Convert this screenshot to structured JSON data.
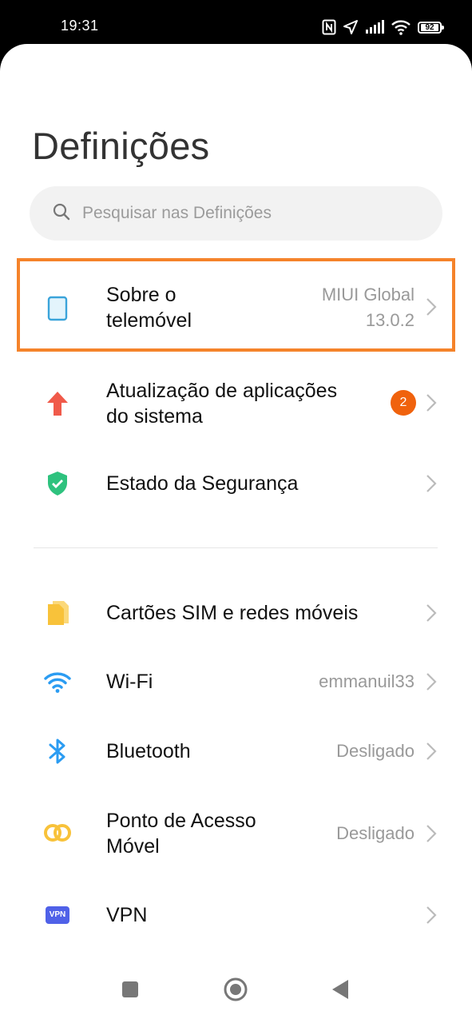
{
  "status_bar": {
    "time": "19:31",
    "battery": "92",
    "icons": [
      "nfc-icon",
      "location-icon",
      "signal-icon",
      "wifi-icon",
      "battery-icon"
    ]
  },
  "page": {
    "title": "Definições"
  },
  "search": {
    "placeholder": "Pesquisar nas Definições",
    "icon": "search-icon"
  },
  "settings": {
    "about": {
      "label_line1": "Sobre o",
      "label_line2": "telemóvel",
      "value_line1": "MIUI Global",
      "value_line2": "13.0.2",
      "icon": "phone-icon",
      "highlighted": true,
      "highlight_color": "#f5832a"
    },
    "updates": {
      "label_line1": "Atualização de aplicações",
      "label_line2": "do sistema",
      "badge": "2",
      "icon": "update-arrow-icon",
      "badge_color": "#f0620d"
    },
    "security": {
      "label": "Estado da Segurança",
      "icon": "shield-icon"
    },
    "sim": {
      "label": "Cartões SIM e redes móveis",
      "icon": "sim-icon"
    },
    "wifi": {
      "label": "Wi-Fi",
      "value": "emmanuil33",
      "icon": "wifi-icon"
    },
    "bluetooth": {
      "label": "Bluetooth",
      "value": "Desligado",
      "icon": "bluetooth-icon"
    },
    "hotspot": {
      "label_line1": "Ponto de Acesso",
      "label_line2": "Móvel",
      "value": "Desligado",
      "icon": "hotspot-icon"
    },
    "vpn": {
      "label": "VPN",
      "icon_text": "VPN",
      "icon": "vpn-icon"
    }
  },
  "nav_bar": {
    "buttons": [
      "recents-button",
      "home-button",
      "back-button"
    ]
  },
  "colors": {
    "accent_highlight": "#f5832a",
    "badge": "#f0620d",
    "security_green": "#2ec27e",
    "sim_yellow": "#f8c23a",
    "wifi_blue": "#2b9cf2",
    "vpn_indigo": "#4f61e8"
  }
}
